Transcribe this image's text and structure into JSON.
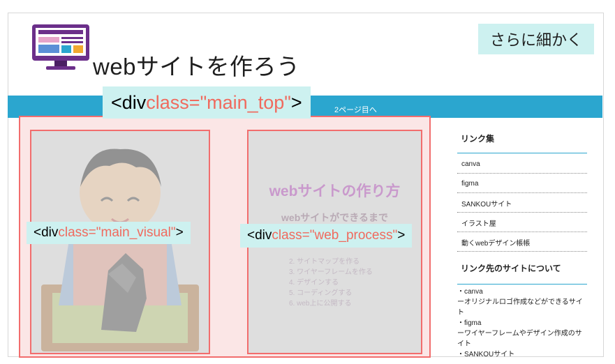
{
  "header": {
    "title": "webサイトを作ろう",
    "detail_button": "さらに細かく"
  },
  "nav": {
    "next_page_link": "2ページ目へ"
  },
  "annotations": {
    "main_top": {
      "tag": "<div ",
      "class_attr": "class=\"main_top\"",
      "close": ">"
    },
    "main_visual": {
      "tag": "<div ",
      "class_attr": "class=\"main_visual\"",
      "close": ">"
    },
    "web_process": {
      "tag": "<div ",
      "class_attr": "class=\"web_process\"",
      "close": ">"
    }
  },
  "web_process": {
    "title": "webサイトの作り方",
    "subtitle": "webサイトができるまで",
    "steps": [
      "2. サイトマップを作る",
      "3. ワイヤーフレームを作る",
      "4. デザインする",
      "5. コーディングする",
      "6. web上に公開する"
    ]
  },
  "sidebar": {
    "links_heading": "リンク集",
    "links": [
      "canva",
      "figma",
      "SANKOUサイト",
      "イラスト屋",
      "動くwebデザイン帳帳"
    ],
    "about_heading": "リンク先のサイトについて",
    "descriptions": [
      "・canva",
      "ーオリジナルロゴ作成などができるサイト",
      "・figma",
      "ーワイヤーフレームやデザイン作成のサイト",
      "・SANKOUサイト"
    ]
  },
  "colors": {
    "nav_bar": "#2ba6cf",
    "annotation_bg": "#cdf1f0",
    "outline": "#f26d6d",
    "class_text": "#f06a5e"
  }
}
